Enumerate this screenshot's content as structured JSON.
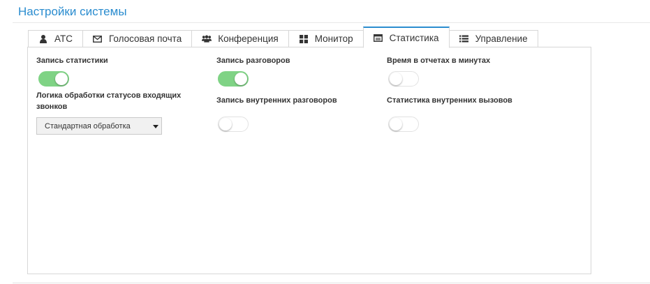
{
  "page": {
    "title": "Настройки системы"
  },
  "tabs": [
    {
      "label": "АТС",
      "icon": "user-icon",
      "active": false
    },
    {
      "label": "Голосовая почта",
      "icon": "envelope-icon",
      "active": false
    },
    {
      "label": "Конференция",
      "icon": "users-icon",
      "active": false
    },
    {
      "label": "Монитор",
      "icon": "grid-icon",
      "active": false
    },
    {
      "label": "Статистика",
      "icon": "card-icon",
      "active": true
    },
    {
      "label": "Управление",
      "icon": "list-icon",
      "active": false
    }
  ],
  "settings": {
    "record_stats": {
      "label": "Запись статистики",
      "on": true
    },
    "record_calls": {
      "label": "Запись разговоров",
      "on": true
    },
    "report_minutes": {
      "label": "Время в отчетах в минутах",
      "on": false
    },
    "status_logic": {
      "label": "Логика обработки статусов входящих звонков",
      "value": "Стандартная обработка"
    },
    "record_internal": {
      "label": "Запись внутренних разговоров",
      "on": false
    },
    "internal_stats": {
      "label": "Статистика внутренних вызовов",
      "on": false
    }
  },
  "colors": {
    "accent": "#2a8ccf",
    "toggle_on": "#7fd385"
  }
}
